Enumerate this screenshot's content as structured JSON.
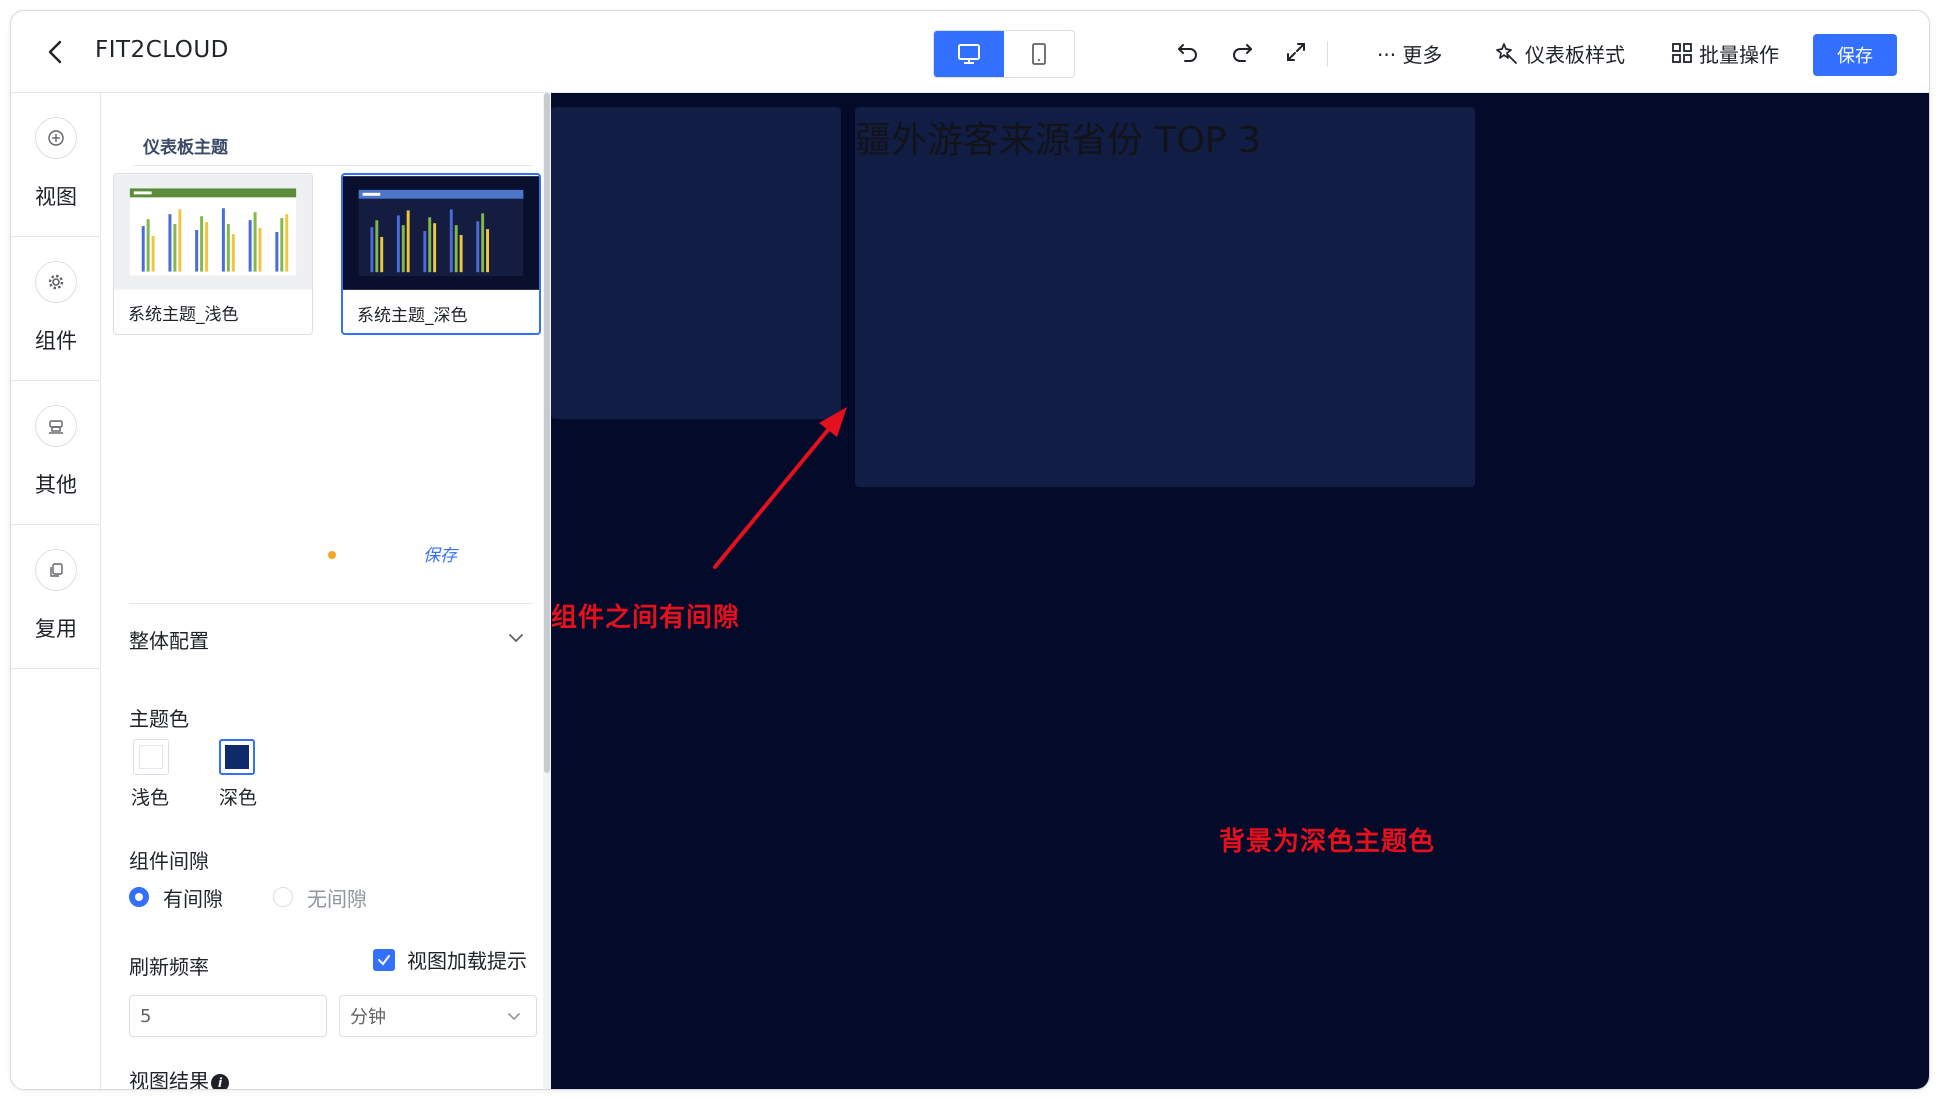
{
  "header": {
    "app_title": "FIT2CLOUD",
    "more_label": "··· 更多",
    "style_label": "仪表板样式",
    "batch_label": "批量操作",
    "save_label": "保存"
  },
  "rail": {
    "items": [
      {
        "label": "视图",
        "icon": "plus-circle-icon"
      },
      {
        "label": "组件",
        "icon": "gear-icon"
      },
      {
        "label": "其他",
        "icon": "stamp-icon"
      },
      {
        "label": "复用",
        "icon": "copy-icon"
      }
    ]
  },
  "panel": {
    "section_title": "仪表板主题",
    "themes": [
      {
        "name": "系统主题_浅色",
        "selected": false
      },
      {
        "name": "系统主题_深色",
        "selected": true
      }
    ],
    "save_link": "保存",
    "overall_config": "整体配置",
    "theme_color_label": "主题色",
    "theme_colors": [
      {
        "label": "浅色",
        "color": "#ffffff",
        "selected": false
      },
      {
        "label": "深色",
        "color": "#0f2a6b",
        "selected": true
      }
    ],
    "gap_label": "组件间隙",
    "gap_options": [
      {
        "label": "有间隙",
        "selected": true
      },
      {
        "label": "无间隙",
        "selected": false
      }
    ],
    "refresh_label": "刷新频率",
    "loading_tip_label": "视图加载提示",
    "loading_tip_checked": true,
    "refresh_value": "5",
    "refresh_unit": "分钟",
    "view_result_label": "视图结果"
  },
  "canvas": {
    "background": "#030a2a",
    "widget_title": "疆外游客来源省份 TOP 3",
    "annotation_gap": "组件之间有间隙",
    "annotation_bg": "背景为深色主题色"
  },
  "colors": {
    "accent": "#3370ff",
    "annotation": "#e5101d",
    "widget_bg": "#121d45"
  }
}
